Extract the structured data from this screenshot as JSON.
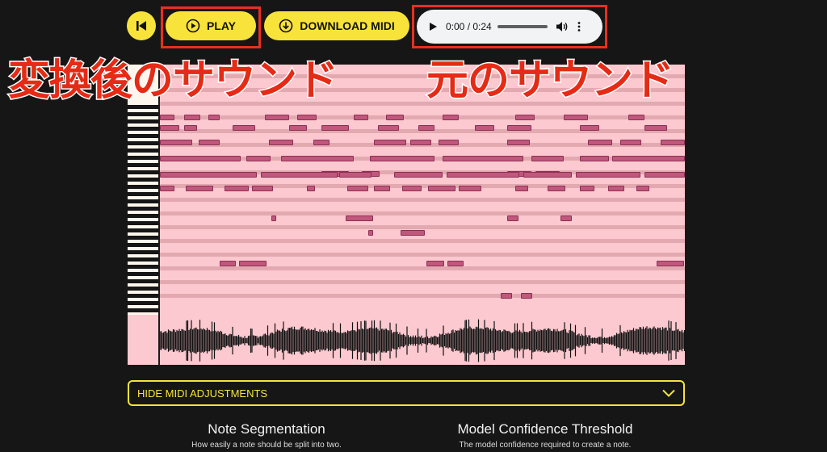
{
  "toolbar": {
    "rewind_icon": "skip-back-icon",
    "play_label": "PLAY",
    "play_icon": "play-circle-icon",
    "download_label": "DOWNLOAD MIDI",
    "download_icon": "download-circle-icon",
    "accent_color": "#f8e33b"
  },
  "audio_player": {
    "time": "0:00 / 0:24",
    "play_icon": "play-icon",
    "volume_icon": "volume-icon",
    "menu_icon": "more-vertical-icon"
  },
  "overlay": {
    "left": "変換後のサウンド",
    "right": "元のサウンド",
    "color": "#e52b16",
    "highlight_color": "#e63021"
  },
  "piano_roll": {
    "background_color": "#fbc9cf",
    "note_color": "#c0587c"
  },
  "adjustments": {
    "toggle_label": "HIDE MIDI ADJUSTMENTS",
    "toggle_icon": "chevron-down-icon",
    "params": [
      {
        "title": "Note Segmentation",
        "description": "How easily a note should be split into two."
      },
      {
        "title": "Model Confidence Threshold",
        "description": "The model confidence required to create a note."
      }
    ]
  }
}
